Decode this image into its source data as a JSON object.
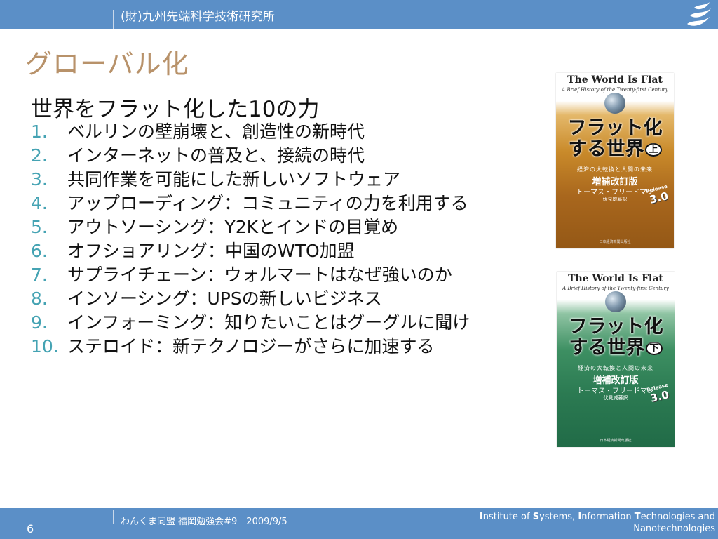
{
  "header": {
    "organization": "(財)九州先端科学技術研究所"
  },
  "slide": {
    "title": "グローバル化",
    "subtitle": "世界をフラット化した10の力",
    "items": [
      {
        "num": "1.",
        "text": "ベルリンの壁崩壊と、創造性の新時代"
      },
      {
        "num": "2.",
        "text": "インターネットの普及と、接続の時代"
      },
      {
        "num": "3.",
        "text": "共同作業を可能にした新しいソフトウェア"
      },
      {
        "num": "4.",
        "text": "アップローディング：コミュニティの力を利用する"
      },
      {
        "num": "5.",
        "text": "アウトソーシング：Y2Kとインドの目覚め"
      },
      {
        "num": "6.",
        "text": "オフショアリング：中国のWTO加盟"
      },
      {
        "num": "7.",
        "text": "サプライチェーン：ウォルマートはなぜ強いのか"
      },
      {
        "num": "8.",
        "text": "インソーシング：UPSの新しいビジネス"
      },
      {
        "num": "9.",
        "text": "インフォーミング：知りたいことはグーグルに聞け"
      },
      {
        "num": "10.",
        "text": "ステロイド：新テクノロジーがさらに加速する"
      }
    ]
  },
  "books": [
    {
      "title_en": "The World Is Flat",
      "subtitle_en": "A Brief History of the Twenty-first Century",
      "title_jp_line1": "フラット化",
      "title_jp_line2": "する世界",
      "volume": "上",
      "tagline": "経済の大転換と人間の未来",
      "edition": "増補改訂版",
      "author": "トーマス・フリードマン",
      "translator": "伏見威蕃訳",
      "badge_top": "Release",
      "badge_num": "3.0",
      "publisher": "日本経済新聞出版社",
      "color": "#b07220"
    },
    {
      "title_en": "The World Is Flat",
      "subtitle_en": "A Brief History of the Twenty-first Century",
      "title_jp_line1": "フラット化",
      "title_jp_line2": "する世界",
      "volume": "下",
      "tagline": "経済の大転換と人間の未来",
      "edition": "増補改訂版",
      "author": "トーマス・フリードマン",
      "translator": "伏見威蕃訳",
      "badge_top": "Release",
      "badge_num": "3.0",
      "publisher": "日本経済新聞出版社",
      "color": "#2b7a52"
    }
  ],
  "footer": {
    "page_number": "6",
    "event": "わんくま同盟 福岡勉強会#9　2009/9/5",
    "institute_line1": {
      "I": "I",
      "r1": "nstitute of ",
      "S": "S",
      "r2": "ystems, ",
      "I2": "I",
      "r3": "nformation ",
      "T": "T",
      "r4": "echnologies and"
    },
    "institute_line2": "Nanotechnologies"
  },
  "colors": {
    "bar_blue": "#5b8fc7",
    "title_tan": "#b8926a",
    "number_teal": "#45a3b3"
  },
  "icons": {
    "logo": "isit-logo-icon"
  }
}
